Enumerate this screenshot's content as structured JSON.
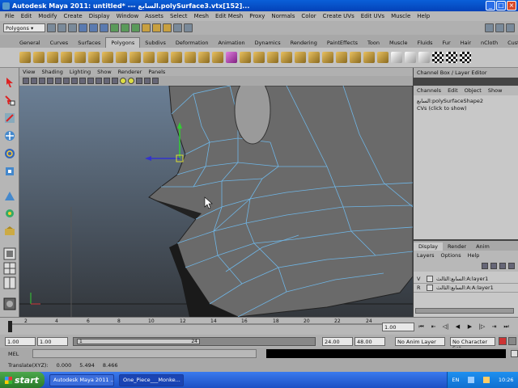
{
  "window": {
    "title": "Autodesk Maya 2011: untitled*   ---   السابع.polySurface3.vtx[152]...",
    "controls": [
      "_",
      "□",
      "×"
    ]
  },
  "menu": [
    "File",
    "Edit",
    "Modify",
    "Create",
    "Display",
    "Window",
    "Assets",
    "Select",
    "Mesh",
    "Edit Mesh",
    "Proxy",
    "Normals",
    "Color",
    "Create UVs",
    "Edit UVs",
    "Muscle",
    "Help"
  ],
  "status_line": {
    "mode": "Polygons"
  },
  "shelf_tabs": [
    "General",
    "Curves",
    "Surfaces",
    "Polygons",
    "Subdivs",
    "Deformation",
    "Animation",
    "Dynamics",
    "Rendering",
    "PaintEffects",
    "Toon",
    "Muscle",
    "Fluids",
    "Fur",
    "Hair",
    "nCloth",
    "Custom"
  ],
  "shelf_tabs_active": "Polygons",
  "viewport_menu": [
    "View",
    "Shading",
    "Lighting",
    "Show",
    "Renderer",
    "Panels"
  ],
  "channel_box": {
    "header": "Channel Box / Layer Editor",
    "menu": [
      "Channels",
      "Edit",
      "Object",
      "Show"
    ],
    "object": "السابع:polySurfaceShape2",
    "cvs": "CVs (click to show)"
  },
  "layer_editor": {
    "tabs": [
      "Display",
      "Render",
      "Anim"
    ],
    "active_tab": "Display",
    "menu": [
      "Layers",
      "Options",
      "Help"
    ],
    "layers": [
      {
        "flag": "V",
        "name": "السابع:الثالث:A:layer1"
      },
      {
        "flag": "R",
        "name": "السابع:الثالث:A:A:layer1"
      }
    ]
  },
  "time_slider": {
    "ticks": [
      "2",
      "4",
      "6",
      "8",
      "10",
      "12",
      "14",
      "16",
      "18",
      "20",
      "22",
      "24"
    ],
    "current_frame": "1.00"
  },
  "range_slider": {
    "start": "1.00",
    "start2": "1.00",
    "range_start": "1",
    "range_end": "24",
    "end": "24.00",
    "end2": "48.00",
    "anim_layer": "No Anim Layer",
    "char_set": "No Character Set"
  },
  "command_line": {
    "label": "MEL"
  },
  "help_line": {
    "label": "Translate(XYZ):",
    "x": "0.000",
    "y": "5.494",
    "z": "8.466"
  },
  "taskbar": {
    "start": "start",
    "tasks": [
      "Autodesk Maya 2011 ...",
      "One_Piece___Monke..."
    ],
    "lang": "EN",
    "time": "10:26"
  }
}
